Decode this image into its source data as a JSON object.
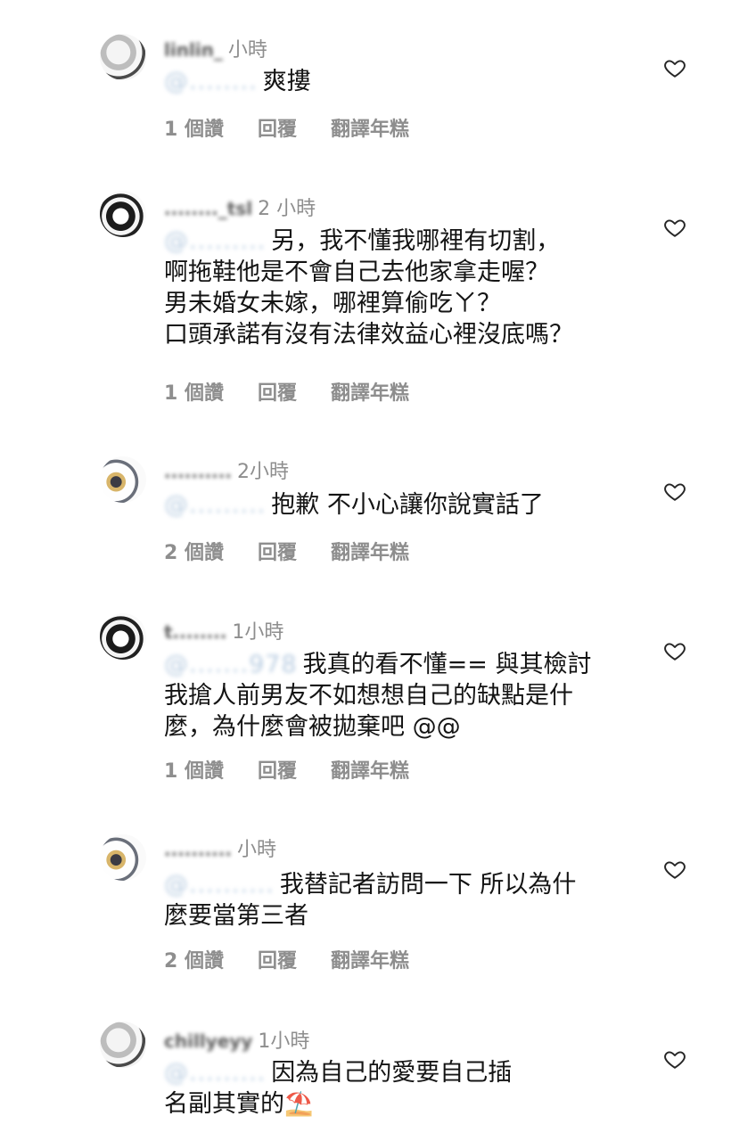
{
  "comments": [
    {
      "username": "linlin_",
      "time": "小時",
      "mention": "@........",
      "lines": [
        "爽摟"
      ],
      "likes": "1 個讚",
      "reply": "回覆",
      "translate": "翻譯年糕"
    },
    {
      "username": "........_tsl",
      "time": "2 小時",
      "mention": "@.........",
      "lines": [
        "另，我不懂我哪裡有切割，",
        "啊拖鞋他是不會自己去他家拿走喔？",
        "男未婚女未嫁，哪裡算偷吃ㄚ？",
        "口頭承諾有沒有法律效益心裡沒底嗎？"
      ],
      "likes": "1 個讚",
      "reply": "回覆",
      "translate": "翻譯年糕"
    },
    {
      "username": "..........",
      "time": "2小時",
      "mention": "@.........",
      "lines": [
        "抱歉 不小心讓你說實話了"
      ],
      "likes": "2 個讚",
      "reply": "回覆",
      "translate": "翻譯年糕"
    },
    {
      "username": "t........",
      "time": "1小時",
      "mention": "@.......978",
      "lines": [
        "我真的看不懂== 與其檢討",
        "我搶人前男友不如想想自己的缺點是什",
        "麼，為什麼會被拋棄吧 @@"
      ],
      "likes": "1 個讚",
      "reply": "回覆",
      "translate": "翻譯年糕"
    },
    {
      "username": "..........",
      "time": "小時",
      "mention": "@..........",
      "lines": [
        "我替記者訪問一下 所以為什",
        "麼要當第三者"
      ],
      "likes": "2 個讚",
      "reply": "回覆",
      "translate": "翻譯年糕"
    },
    {
      "username": "chillyeyy",
      "time": "1小時",
      "mention": "@.........",
      "lines": [
        "因為自己的愛要自己插",
        "名副其實的"
      ],
      "emoji": "⛱️",
      "likes": "",
      "reply": "",
      "translate": ""
    }
  ]
}
